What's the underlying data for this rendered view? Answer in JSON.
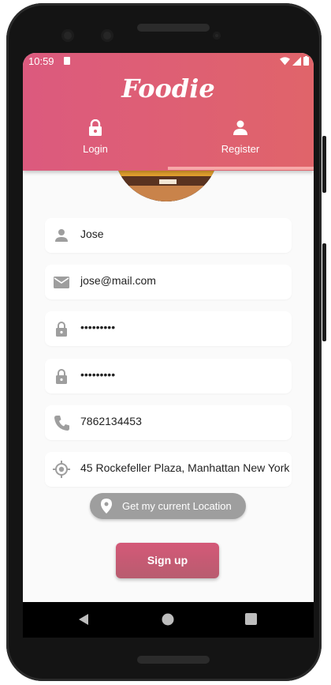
{
  "status_bar": {
    "time": "10:59"
  },
  "app": {
    "title": "Foodie"
  },
  "tabs": [
    {
      "label": "Login",
      "icon": "lock-icon",
      "selected": false
    },
    {
      "label": "Register",
      "icon": "person-icon",
      "selected": true
    }
  ],
  "form": {
    "name": "Jose",
    "email": "jose@mail.com",
    "password": "•••••••••",
    "confirm_password": "•••••••••",
    "phone": "7862134453",
    "address": "45 Rockefeller Plaza, Manhattan New York"
  },
  "location_button": {
    "label": "Get my current Location"
  },
  "signup_button": {
    "label": "Sign up"
  },
  "colors": {
    "header_start": "#dc5a7e",
    "header_end": "#e0646a",
    "icon_gray": "#9e9e9e"
  }
}
